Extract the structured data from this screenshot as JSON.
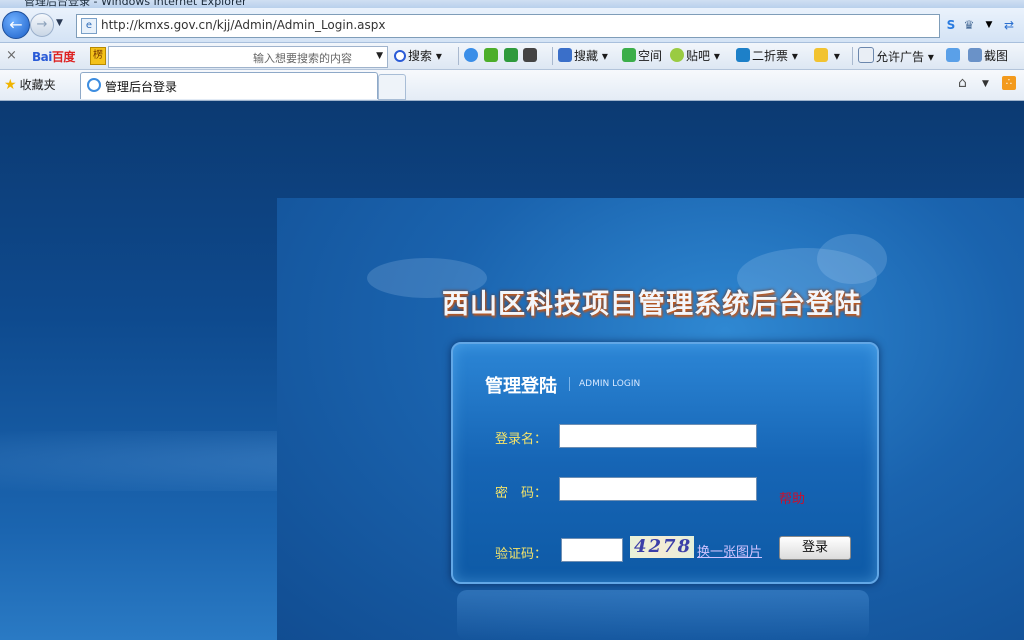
{
  "window": {
    "title": "管理后台登录 - Windows Internet Explorer"
  },
  "address_bar": {
    "url": "http://kmxs.gov.cn/kjj/Admin/Admin_Login.aspx"
  },
  "toolbar": {
    "logo_text": "百度",
    "logo_prefix": "Bai",
    "search_placeholder": "输入想要搜索的内容",
    "search_label": "搜索",
    "collect_label": "搜藏",
    "space_label": "空间",
    "tieba_label": "贴吧",
    "discount_label": "二折票",
    "allow_ads_label": "允许广告",
    "screenshot_label": "截图"
  },
  "favorites_bar": {
    "favorites_label": "收藏夹"
  },
  "tabs": [
    {
      "label": "管理后台登录"
    }
  ],
  "page": {
    "system_title": "西山区科技项目管理系统后台登陆",
    "login": {
      "heading": "管理登陆",
      "subheading": "ADMIN LOGIN",
      "username_label": "登录名：",
      "password_label": "密　码：",
      "help_label": "帮助",
      "captcha_label": "验证码：",
      "captcha_value": "4278",
      "refresh_link": "换一张图片",
      "submit_label": "登录"
    }
  },
  "colors": {
    "page_bg": "#0e4a8e",
    "accent": "#f5e46a",
    "help": "#c8102e"
  }
}
